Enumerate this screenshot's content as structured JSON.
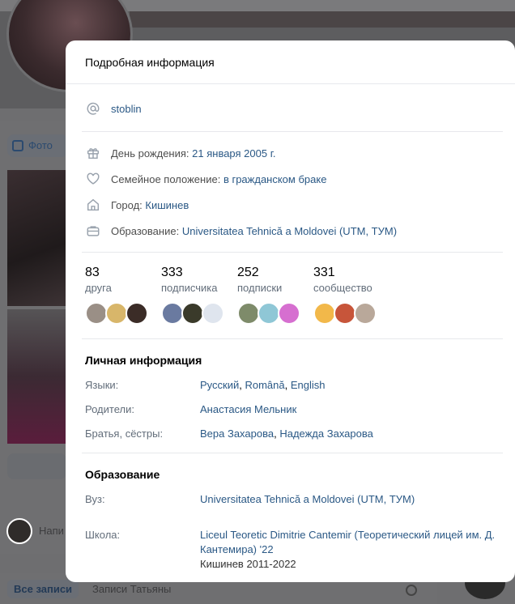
{
  "background": {
    "photo_button": "Фото",
    "composer_placeholder": "Напи",
    "tab_all": "Все записи",
    "tab_user": "Записи Татьяны"
  },
  "modal": {
    "title": "Подробная информация",
    "username": "stoblin",
    "birthday_label": "День рождения:",
    "birthday_value": "21 января 2005 г.",
    "relationship_label": "Семейное положение:",
    "relationship_value": "в гражданском браке",
    "city_label": "Город:",
    "city_value": "Кишинев",
    "education_label": "Образование:",
    "education_value": "Universitatea Tehnică a Moldovei (UTM, ТУМ)",
    "counters": [
      {
        "count": "83",
        "caption": "друга",
        "avatars": [
          "#9a8f86",
          "#d8b66a",
          "#3b2c27"
        ]
      },
      {
        "count": "333",
        "caption": "подписчика",
        "avatars": [
          "#6a7aa0",
          "#3a3a2a",
          "#dfe5ee"
        ]
      },
      {
        "count": "252",
        "caption": "подписки",
        "avatars": [
          "#7e8b6a",
          "#8fc7d6",
          "#d66fd0"
        ]
      },
      {
        "count": "331",
        "caption": "сообщество",
        "avatars": [
          "#f2b84a",
          "#c7553a",
          "#b9a89a"
        ]
      }
    ],
    "personal": {
      "heading": "Личная информация",
      "languages_label": "Языки:",
      "languages": [
        "Русский",
        "Română",
        "English"
      ],
      "parents_label": "Родители:",
      "parents_value": "Анастасия Мельник",
      "siblings_label": "Братья, сёстры:",
      "siblings": [
        "Вера Захарова",
        "Надежда Захарова"
      ]
    },
    "education": {
      "heading": "Образование",
      "university_label": "Вуз:",
      "university_value": "Universitatea Tehnică a Moldovei (UTM, ТУМ)",
      "school_label": "Школа:",
      "school_value": "Liceul Teoretic Dimitrie Cantemir (Теоретический лицей им. Д. Кантемира) '22",
      "school_details": "Кишинев 2011-2022"
    }
  },
  "colors": {
    "link": "#2a5885",
    "secondary_text": "#626d7a",
    "overlay": "#6e6e70"
  }
}
